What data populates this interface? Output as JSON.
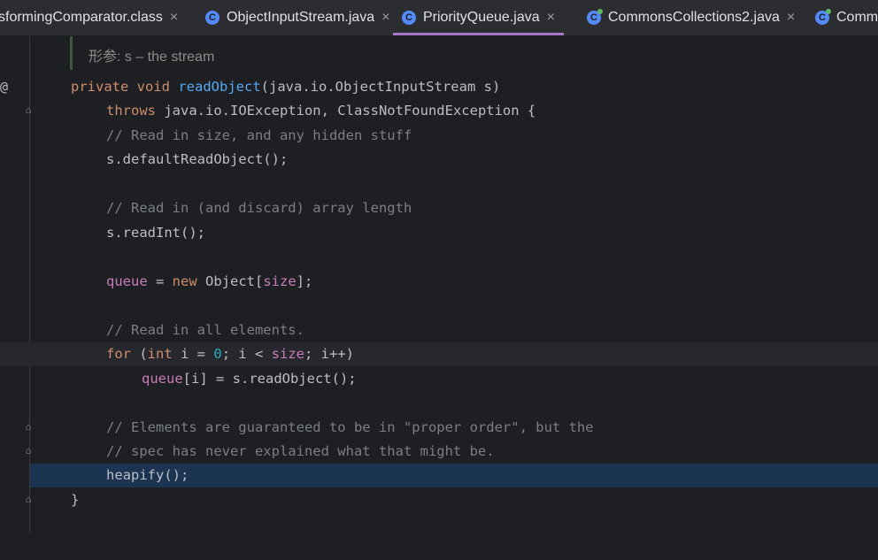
{
  "tabs": [
    {
      "label": "sformingComparator.class",
      "icon": "",
      "active": false
    },
    {
      "label": "ObjectInputStream.java",
      "icon": "C",
      "active": false
    },
    {
      "label": "PriorityQueue.java",
      "icon": "C",
      "active": true
    },
    {
      "label": "CommonsCollections2.java",
      "icon": "C",
      "active": false
    },
    {
      "label": "Comm",
      "icon": "C",
      "active": false
    }
  ],
  "close_glyph": "×",
  "doc_param": "形参: s – the stream",
  "gutter_at": "@",
  "code": {
    "l1": {
      "kw1": "private",
      "kw2": "void",
      "fn": "readObject",
      "rest": "(java.io.ObjectInputStream s)"
    },
    "l2": {
      "kw": "throws",
      "rest": " java.io.IOException, ClassNotFoundException {"
    },
    "l3": "// Read in size, and any hidden stuff",
    "l4": "s.defaultReadObject();",
    "l6": "// Read in (and discard) array length",
    "l7": "s.readInt();",
    "l9": {
      "fld1": "queue",
      "op": " = ",
      "kw": "new",
      "mid": " Object[",
      "fld2": "size",
      "end": "];"
    },
    "l11": "// Read in all elements.",
    "l12": {
      "kw1": "for",
      "p1": " (",
      "kw2": "int",
      "a": " i = ",
      "num": "0",
      "b": "; i < ",
      "fld": "size",
      "c": "; i++)"
    },
    "l13": {
      "fld": "queue",
      "rest": "[i] = s.readObject();"
    },
    "l15": "// Elements are guaranteed to be in \"proper order\", but the",
    "l16": "// spec has never explained what that might be.",
    "l17": "heapify();",
    "l18": "}"
  }
}
